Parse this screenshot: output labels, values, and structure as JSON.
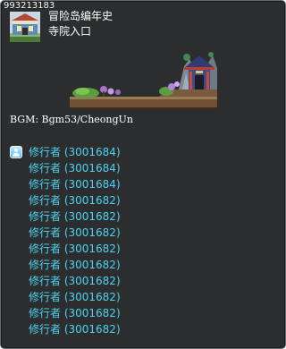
{
  "map_id": "993213183",
  "region_name": "冒险岛编年史",
  "map_name": "寺院入口",
  "bgm": "BGM: Bgm53/CheongUn",
  "npc_icon": "npc-person-icon",
  "npcs": [
    {
      "label": "修行者 (3001684)"
    },
    {
      "label": "修行者 (3001684)"
    },
    {
      "label": "修行者 (3001684)"
    },
    {
      "label": "修行者 (3001682)"
    },
    {
      "label": "修行者 (3001682)"
    },
    {
      "label": "修行者 (3001682)"
    },
    {
      "label": "修行者 (3001682)"
    },
    {
      "label": "修行者 (3001682)"
    },
    {
      "label": "修行者 (3001682)"
    },
    {
      "label": "修行者 (3001682)"
    },
    {
      "label": "修行者 (3001682)"
    },
    {
      "label": "修行者 (3001682)"
    }
  ],
  "colors": {
    "background": "#2b2d2f",
    "npc_text": "#4fd3ef",
    "text": "#ffffff"
  }
}
